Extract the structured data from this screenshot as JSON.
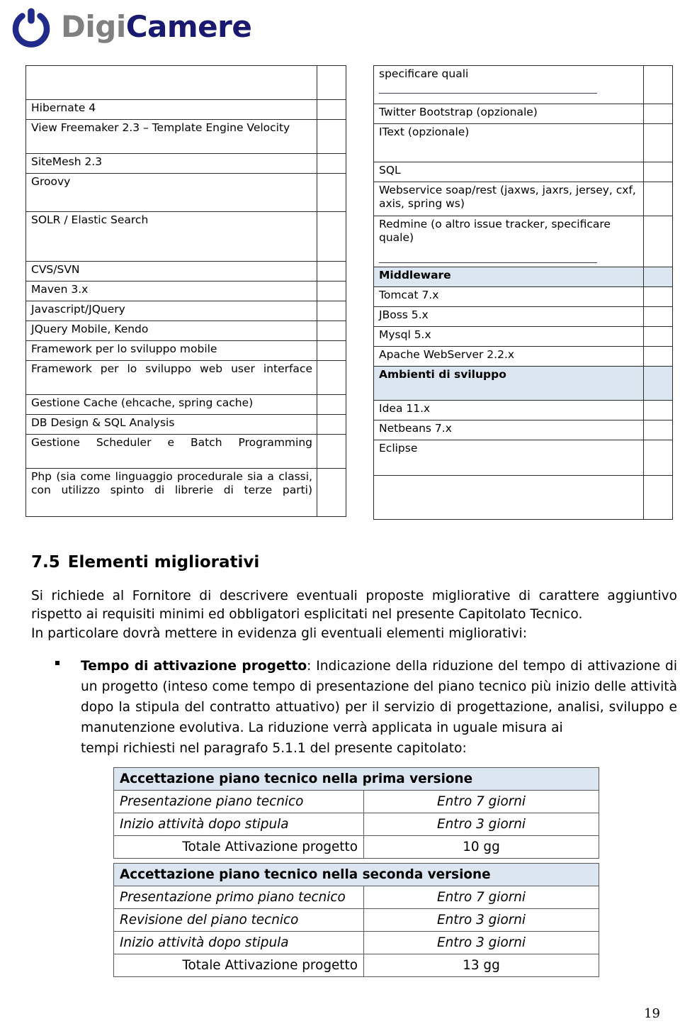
{
  "logo": {
    "icon": "power-button-icon",
    "text_part1": "Digi",
    "text_part2": "Camere",
    "color_gray": "#808080",
    "color_navy": "#191970"
  },
  "colors": {
    "table_header_fill": "#dce6f1",
    "table_border": "#2b2b2b",
    "bottom_table_border": "#595959"
  },
  "left_table": {
    "rows": [
      {
        "label": "",
        "kind": "blank-tall"
      },
      {
        "label": "Hibernate 4",
        "kind": "normal"
      },
      {
        "label": "View Freemaker 2.3 – Template Engine Velocity",
        "kind": "normal"
      },
      {
        "label": "SiteMesh 2.3",
        "kind": "normal"
      },
      {
        "label": "Groovy",
        "kind": "tall"
      },
      {
        "label": "SOLR / Elastic Search",
        "kind": "tall"
      },
      {
        "label": "CVS/SVN",
        "kind": "normal"
      },
      {
        "label": "Maven 3.x",
        "kind": "normal"
      },
      {
        "label": "Javascript/JQuery",
        "kind": "normal"
      },
      {
        "label": "JQuery Mobile, Kendo",
        "kind": "normal"
      },
      {
        "label": "Framework per lo sviluppo mobile",
        "kind": "normal"
      },
      {
        "label": "Framework per lo sviluppo web user interface",
        "kind": "justify"
      },
      {
        "label": "Gestione Cache (ehcache, spring cache)",
        "kind": "normal"
      },
      {
        "label": "DB Design & SQL Analysis",
        "kind": "normal"
      },
      {
        "label": "Gestione Scheduler e Batch Programming",
        "kind": "justify"
      },
      {
        "label": "Php (sia come linguaggio procedurale sia a classi, con utilizzo spinto di librerie di terze parti)",
        "kind": "justify"
      }
    ]
  },
  "right_table": {
    "rows": [
      {
        "label": "specificare quali",
        "kind": "underlined"
      },
      {
        "label": "Twitter Bootstrap (opzionale)",
        "kind": "normal"
      },
      {
        "label": "IText (opzionale)",
        "kind": "tall"
      },
      {
        "label": "SQL",
        "kind": "normal"
      },
      {
        "label": "Webservice soap/rest (jaxws, jaxrs, jersey, cxf, axis, spring ws)",
        "kind": "normal"
      },
      {
        "label": "Redmine (o altro issue tracker, specificare quale)",
        "kind": "underlined-tall"
      },
      {
        "label": "Middleware",
        "kind": "header"
      },
      {
        "label": "Tomcat 7.x",
        "kind": "normal"
      },
      {
        "label": "JBoss 5.x",
        "kind": "normal"
      },
      {
        "label": "Mysql 5.x",
        "kind": "normal"
      },
      {
        "label": "Apache WebServer 2.2.x",
        "kind": "normal"
      },
      {
        "label": "Ambienti di sviluppo",
        "kind": "header-tall"
      },
      {
        "label": "Idea 11.x",
        "kind": "normal"
      },
      {
        "label": "Netbeans 7.x",
        "kind": "normal"
      },
      {
        "label": "Eclipse",
        "kind": "tall"
      },
      {
        "label": "",
        "kind": "blank-tall"
      }
    ]
  },
  "section": {
    "number": "7.5",
    "title": "Elementi migliorativi"
  },
  "paragraph": {
    "line1": "Si richiede al Fornitore di descrivere eventuali proposte migliorative di carattere aggiuntivo",
    "line2": "rispetto ai requisiti minimi ed obbligatori esplicitati nel presente Capitolato Tecnico.",
    "line3": "In particolare dovrà mettere in evidenza gli eventuali elementi migliorativi:"
  },
  "bullet": {
    "marker": "square-bullet",
    "lead": "Tempo di attivazione progetto",
    "body": ": Indicazione della riduzione del tempo di attivazione di un progetto (inteso come tempo di presentazione del piano tecnico più inizio delle attività dopo la stipula del contratto attuativo) per il servizio di progettazione, analisi, sviluppo e manutenzione evolutiva. La riduzione verrà applicata in uguale misura ai",
    "last_line": "tempi richiesti nel paragrafo 5.1.1  del presente capitolato:"
  },
  "table_first_version": {
    "header": "Accettazione piano tecnico nella prima versione",
    "rows": [
      {
        "label": "Presentazione piano tecnico",
        "value": "Entro 7 giorni",
        "type": "item"
      },
      {
        "label": "Inizio attività dopo stipula",
        "value": "Entro 3 giorni",
        "type": "item"
      },
      {
        "label": "Totale Attivazione progetto",
        "value": "10 gg",
        "type": "total"
      }
    ]
  },
  "table_second_version": {
    "header": "Accettazione piano tecnico nella seconda versione",
    "rows": [
      {
        "label": "Presentazione primo piano tecnico",
        "value": "Entro 7 giorni",
        "type": "item"
      },
      {
        "label": "Revisione del piano tecnico",
        "value": "Entro 3 giorni",
        "type": "item"
      },
      {
        "label": "Inizio attività dopo stipula",
        "value": "Entro 3 giorni",
        "type": "item"
      },
      {
        "label": "Totale Attivazione progetto",
        "value": "13 gg",
        "type": "total"
      }
    ]
  },
  "footer": {
    "page_number": "19"
  }
}
